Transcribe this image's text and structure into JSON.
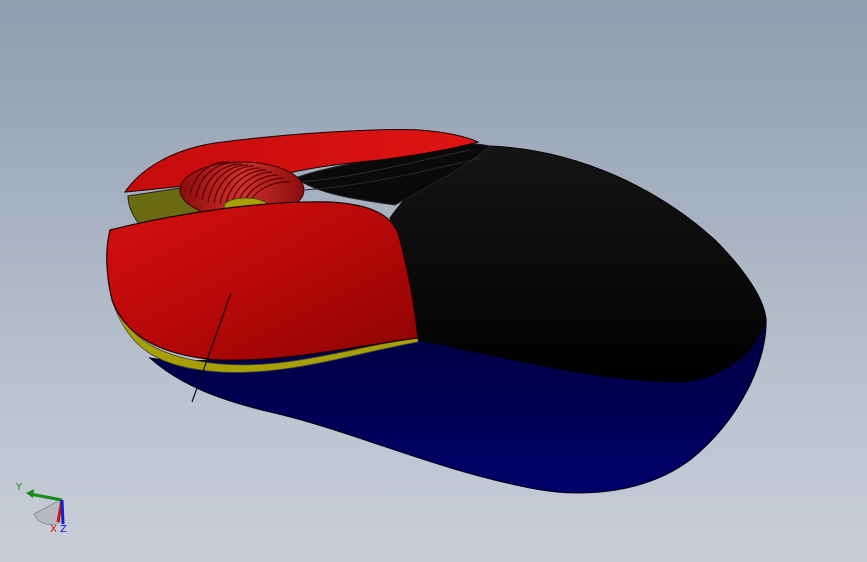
{
  "viewport": {
    "background_top": "#8f9db0",
    "background_bottom": "#c8cdd6"
  },
  "model": {
    "parts": [
      {
        "name": "top-shell",
        "color": "#cc0a0a"
      },
      {
        "name": "side-panel",
        "color": "#050505"
      },
      {
        "name": "bottom-base",
        "color": "#00005a"
      },
      {
        "name": "seam-strip",
        "color": "#a8a000"
      },
      {
        "name": "scroll-wheel",
        "color": "#b81414"
      }
    ]
  },
  "triad": {
    "x_label": "X",
    "y_label": "Y",
    "z_label": "Z",
    "x_color": "#d01010",
    "y_color": "#1a8a1a",
    "z_color": "#1020d0"
  }
}
